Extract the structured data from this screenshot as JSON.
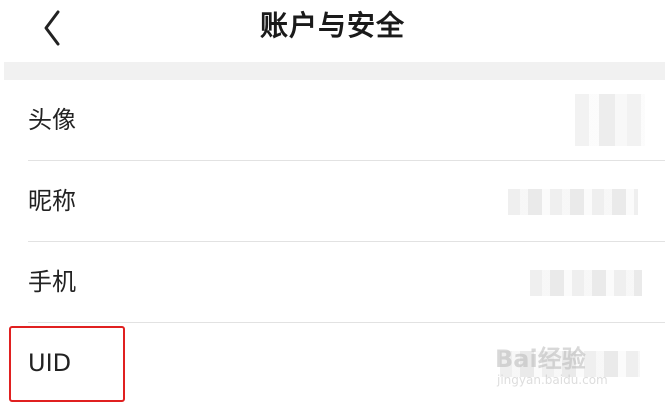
{
  "header": {
    "title": "账户与安全",
    "back_icon": "chevron-left-icon"
  },
  "rows": [
    {
      "label": "头像"
    },
    {
      "label": "昵称"
    },
    {
      "label": "手机"
    },
    {
      "label": "UID"
    }
  ],
  "colors": {
    "highlight": "#e02020",
    "divider": "#e2e2e2",
    "section_gap": "#f1f1f1"
  },
  "watermark": {
    "text": "Bai经验",
    "sub": "jingyan.baidu.com"
  }
}
